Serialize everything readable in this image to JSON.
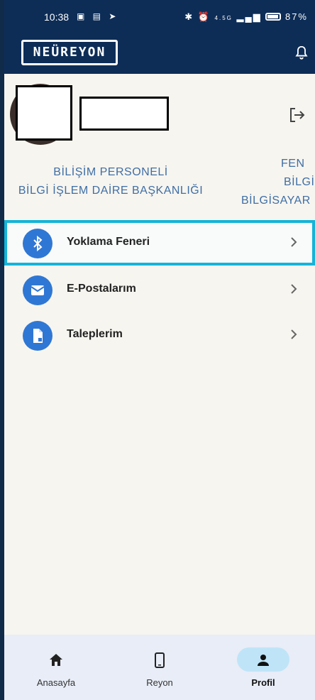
{
  "status_bar": {
    "time": "10:38",
    "battery": "87%",
    "network": "4.5G"
  },
  "app_bar": {
    "logo_text": "NEÜREYON"
  },
  "profile": {
    "department_line1": "BİLİŞİM PERSONELİ",
    "department_line2": "BİLGİ İŞLEM DAİRE BAŞKANLIĞI",
    "side_line1": "FEN",
    "side_line2": "BİLGİ",
    "side_line3": "BİLGİSAYAR"
  },
  "menu": {
    "items": [
      {
        "label": "Yoklama Feneri",
        "icon": "bluetooth-icon",
        "selected": true
      },
      {
        "label": "E-Postalarım",
        "icon": "mail-icon",
        "selected": false
      },
      {
        "label": "Taleplerim",
        "icon": "request-document-icon",
        "selected": false
      }
    ]
  },
  "bottom_nav": {
    "items": [
      {
        "label": "Anasayfa",
        "icon": "home-icon",
        "active": false
      },
      {
        "label": "Reyon",
        "icon": "phone-icon",
        "active": false
      },
      {
        "label": "Profil",
        "icon": "person-icon",
        "active": true
      }
    ]
  },
  "colors": {
    "header": "#0d2d57",
    "accent": "#2f77d4",
    "highlight": "#14b4d8",
    "dept_text": "#3e6ea6"
  }
}
